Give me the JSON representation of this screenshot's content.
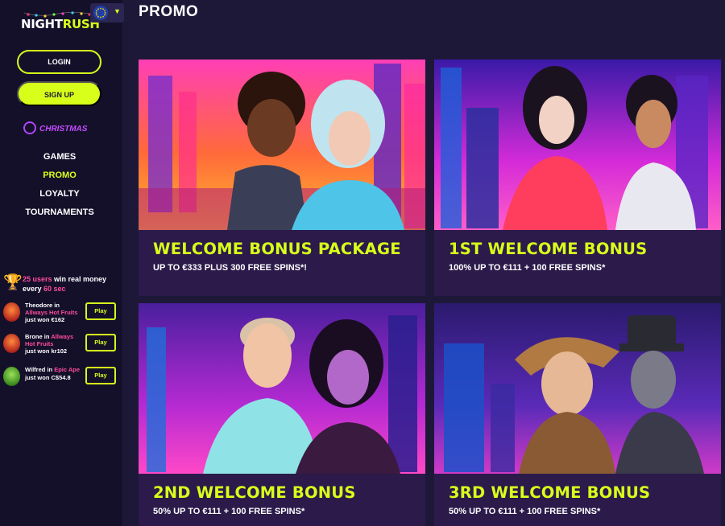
{
  "brand": {
    "logo_part1": "NIGHT",
    "logo_part2": "RUSH"
  },
  "language": {
    "flag_icon": "eu-flag-icon",
    "chevron_icon": "chevron-down-icon"
  },
  "auth": {
    "login_label": "LOGIN",
    "signup_label": "SIGN UP"
  },
  "promo_banner": {
    "label": "CHRISTMAS",
    "icon": "christmas-ornament-icon"
  },
  "nav": {
    "items": [
      {
        "label": "GAMES",
        "active": false
      },
      {
        "label": "PROMO",
        "active": true
      },
      {
        "label": "LOYALTY",
        "active": false
      },
      {
        "label": "TOURNAMENTS",
        "active": false
      }
    ]
  },
  "winners": {
    "headline_count": "25 users",
    "headline_mid": " win real money",
    "headline_every": "every ",
    "headline_time": "60 sec",
    "trophy_icon": "trophy-icon",
    "items": [
      {
        "name": "Theodore",
        "in": " in ",
        "game": "Allways Hot Fruits",
        "won_prefix": "just won ",
        "amount": "€162",
        "play_label": "Play"
      },
      {
        "name": "Brone",
        "in": " in ",
        "game": "Allways Hot Fruits",
        "won_prefix": "just won ",
        "amount": "kr102",
        "play_label": "Play"
      },
      {
        "name": "Wilfred",
        "in": " in ",
        "game": "Epic Ape",
        "won_prefix": "just won ",
        "amount": "C$54.8",
        "play_label": "Play"
      }
    ]
  },
  "page": {
    "title": "PROMO"
  },
  "promos": [
    {
      "title": "WELCOME BONUS PACKAGE",
      "subtitle": "UP TO €333 PLUS 300 FREE SPINS*!"
    },
    {
      "title": "1ST WELCOME BONUS",
      "subtitle": "100% UP TO €111 + 100 FREE SPINS*"
    },
    {
      "title": "2ND WELCOME BONUS",
      "subtitle": "50% UP TO €111 + 100 FREE SPINS*"
    },
    {
      "title": "3RD WELCOME BONUS",
      "subtitle": "50% UP TO €111 + 100 FREE SPINS*"
    }
  ],
  "colors": {
    "accent": "#d8ff1a",
    "sidebar_bg": "#14102a",
    "page_bg": "#1e1838",
    "card_body": "#2b1a4a",
    "highlight": "#ff4c9e"
  }
}
